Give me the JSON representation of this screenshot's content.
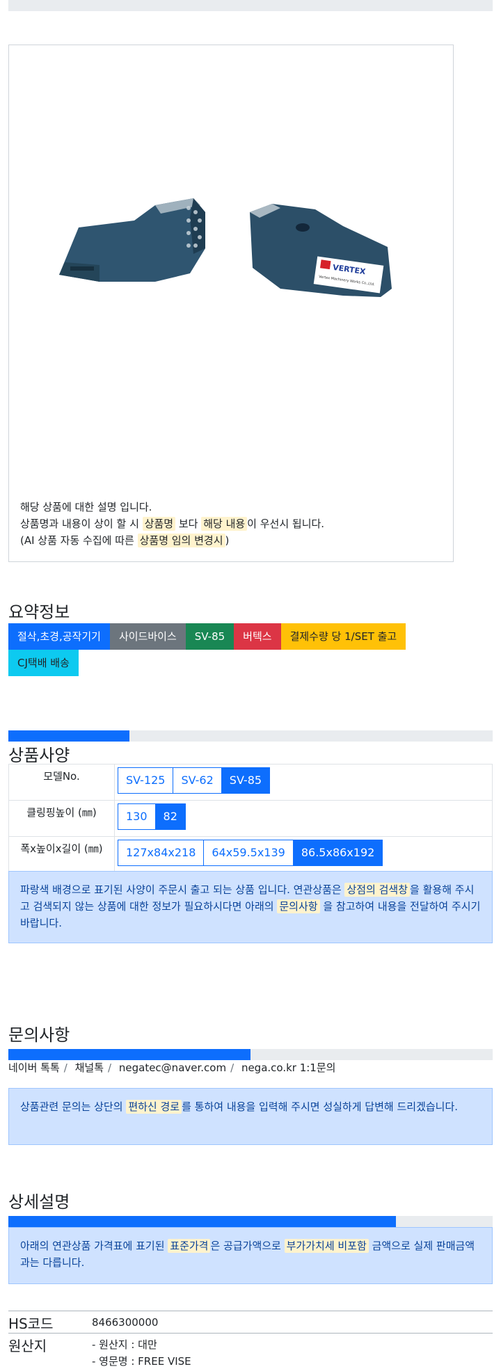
{
  "product": {
    "description": {
      "line1": "해당 상품에 대한 설명 입니다.",
      "line2_a": "상품명과 내용이 상이 할 시 ",
      "line2_mark1": "상품명",
      "line2_b": " 보다 ",
      "line2_mark2": "해당 내용",
      "line2_c": "이 우선시 됩니다.",
      "line3_a": "(AI 상품 자동 수집에 따른 ",
      "line3_mark": "상품명 임의 변경시",
      "line3_b": ")"
    },
    "image_label": "VERTEX",
    "image_sublabel": "Vertex Machinery Works Co.,Ltd."
  },
  "summary": {
    "title": "요약정보",
    "tags": [
      "절삭,초경,공작기기",
      "사이드바이스",
      "SV-85",
      "버텍스",
      "결제수량 당 1/SET 출고",
      "CJ택배 배송"
    ]
  },
  "specs": {
    "title": "상품사양",
    "progress": 0.25,
    "rows": [
      {
        "label": "모델No.",
        "options": [
          "SV-125",
          "SV-62",
          "SV-85"
        ],
        "selected": 2
      },
      {
        "label": "클링핑높이 (㎜)",
        "options": [
          "130",
          "82"
        ],
        "selected": 1
      },
      {
        "label": "폭x높이x길이 (㎜)",
        "options": [
          "127x84x218",
          "64x59.5x139",
          "86.5x86x192"
        ],
        "selected": 2
      }
    ],
    "notice_a": "파랑색 배경으로 표기된 사양이 주문시 출고 되는 상품 입니다. 연관상품은 ",
    "notice_mark1": "상점의 검색창",
    "notice_b": "을 활용해 주시고 검색되지 않는 상품에 대한 정보가 필요하시다면 아래의 ",
    "notice_mark2": "문의사항",
    "notice_c": " 을 참고하여 내용을 전달하여 주시기 바랍니다."
  },
  "inquiry": {
    "title": "문의사항",
    "progress": 0.5,
    "channels": [
      "네이버 톡톡",
      "채널톡",
      "negatec@naver.com",
      "nega.co.kr 1:1문의"
    ],
    "notice_a": "상품관련 문의는 상단의 ",
    "notice_mark": "편하신 경로",
    "notice_b": "를 통하여 내용을 입력해 주시면 성실하게 답변해 드리겠습니다."
  },
  "detail": {
    "title": "상세설명",
    "progress": 0.8,
    "notice_a": "아래의 연관상품 가격표에 표기된 ",
    "notice_mark1": "표준가격",
    "notice_b": "은 공급가액으로 ",
    "notice_mark2": "부가가치세 비포함",
    "notice_c": " 금액으로 실제 판매금액과는 다릅니다."
  },
  "info": {
    "hs_label": "HS코드",
    "hs_value": "8466300000",
    "origin_label": "원산지",
    "origin_line1": "- 원산지 : 대만",
    "origin_line2": "- 영문명 : FREE VISE"
  }
}
